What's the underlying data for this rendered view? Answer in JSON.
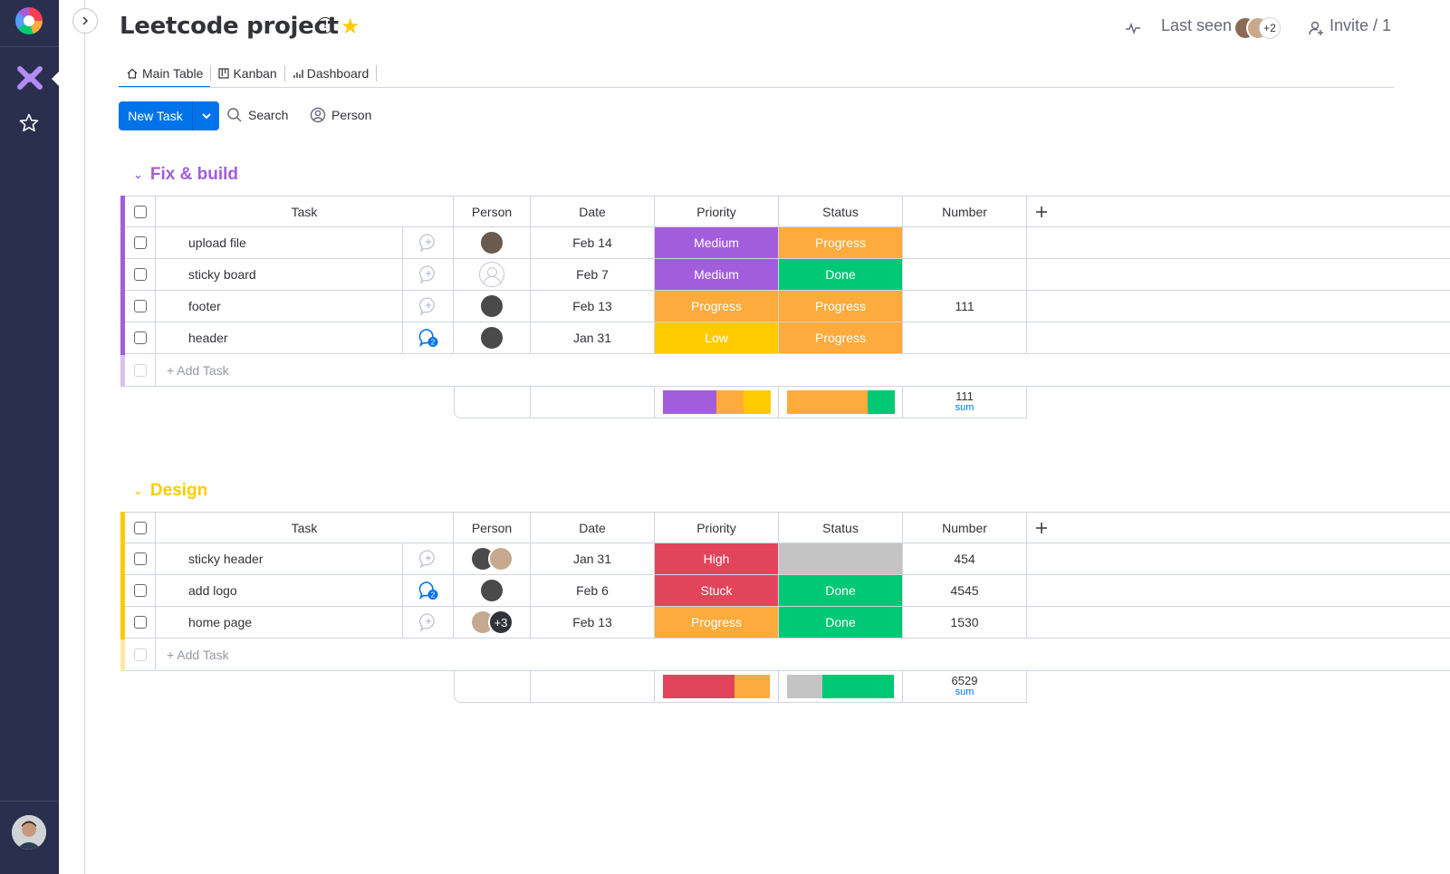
{
  "board": {
    "title": "Leetcode project",
    "last_seen_label": "Last seen",
    "last_seen_more": "+2",
    "invite_label": "Invite / 1"
  },
  "tabs": [
    {
      "label": "Main Table",
      "icon": "home-icon",
      "active": true
    },
    {
      "label": "Kanban",
      "icon": "kanban-icon",
      "active": false
    },
    {
      "label": "Dashboard",
      "icon": "chart-icon",
      "active": false
    }
  ],
  "toolbar": {
    "new_task_label": "New Task",
    "search_label": "Search",
    "person_label": "Person"
  },
  "columns": {
    "task": "Task",
    "person": "Person",
    "date": "Date",
    "priority": "Priority",
    "status": "Status",
    "number": "Number"
  },
  "colors": {
    "accent": "#0073ea",
    "medium": "#a25ddc",
    "progress": "#fdab3d",
    "done": "#00c875",
    "low": "#ffcb00",
    "high": "#e2445c",
    "stuck": "#e2445c",
    "empty": "#c4c4c4"
  },
  "groups": [
    {
      "name": "Fix & build",
      "color": "#a25ddc",
      "add_task_label": "+ Add Task",
      "tasks": [
        {
          "name": "upload file",
          "comments": "",
          "date": "Feb 14",
          "priority": "Medium",
          "priority_color": "#a25ddc",
          "status": "Progress",
          "status_color": "#fdab3d",
          "number": ""
        },
        {
          "name": "sticky board",
          "comments": "",
          "date": "Feb 7",
          "priority": "Medium",
          "priority_color": "#a25ddc",
          "status": "Done",
          "status_color": "#00c875",
          "number": ""
        },
        {
          "name": "footer",
          "comments": "",
          "date": "Feb 13",
          "priority": "Progress",
          "priority_color": "#fdab3d",
          "status": "Progress",
          "status_color": "#fdab3d",
          "number": "111"
        },
        {
          "name": "header",
          "comments": "2",
          "date": "Jan 31",
          "priority": "Low",
          "priority_color": "#ffcb00",
          "status": "Progress",
          "status_color": "#fdab3d",
          "number": ""
        }
      ],
      "summary": {
        "sum_value": "111",
        "sum_label": "sum",
        "priority_share": [
          {
            "color": "#a25ddc",
            "fraction": 0.5
          },
          {
            "color": "#fdab3d",
            "fraction": 0.25
          },
          {
            "color": "#ffcb00",
            "fraction": 0.25
          }
        ],
        "status_share": [
          {
            "color": "#fdab3d",
            "fraction": 0.75
          },
          {
            "color": "#00c875",
            "fraction": 0.25
          }
        ]
      }
    },
    {
      "name": "Design",
      "color": "#ffcb00",
      "add_task_label": "+ Add Task",
      "tasks": [
        {
          "name": "sticky header",
          "comments": "",
          "date": "Jan 31",
          "priority": "High",
          "priority_color": "#e2445c",
          "status": "",
          "status_color": "#c4c4c4",
          "number": "454"
        },
        {
          "name": "add logo",
          "comments": "2",
          "date": "Feb 6",
          "priority": "Stuck",
          "priority_color": "#e2445c",
          "status": "Done",
          "status_color": "#00c875",
          "number": "4545"
        },
        {
          "name": "home page",
          "comments": "",
          "date": "Feb 13",
          "priority": "Progress",
          "priority_color": "#fdab3d",
          "status": "Done",
          "status_color": "#00c875",
          "number": "1530",
          "person_more": "+3"
        }
      ],
      "summary": {
        "sum_value": "6529",
        "sum_label": "sum",
        "priority_share": [
          {
            "color": "#e2445c",
            "fraction": 0.667
          },
          {
            "color": "#fdab3d",
            "fraction": 0.333
          }
        ],
        "status_share": [
          {
            "color": "#c4c4c4",
            "fraction": 0.333
          },
          {
            "color": "#00c875",
            "fraction": 0.667
          }
        ]
      }
    }
  ]
}
